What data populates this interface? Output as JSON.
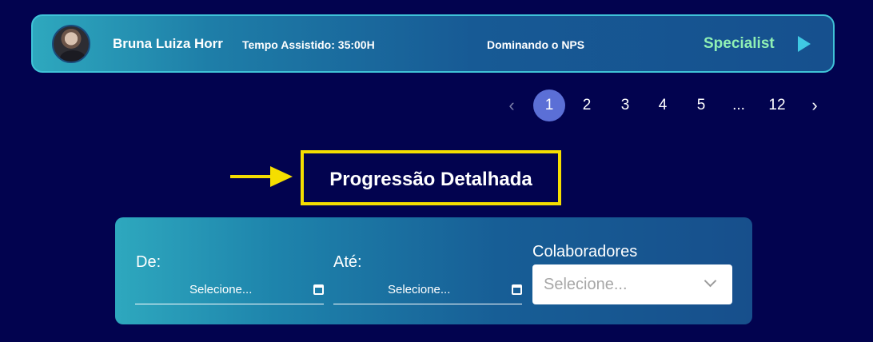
{
  "user_card": {
    "name": "Bruna Luiza Horr",
    "watch_time": "Tempo Assistido: 35:00H",
    "course": "Dominando o NPS",
    "level": "Specialist"
  },
  "pagination": {
    "prev": "‹",
    "pages": [
      "1",
      "2",
      "3",
      "4",
      "5",
      "...",
      "12"
    ],
    "active": "1",
    "next": "›"
  },
  "section": {
    "title": "Progressão Detalhada"
  },
  "filters": {
    "from_label": "De:",
    "from_value": "Selecione...",
    "to_label": "Até:",
    "to_value": "Selecione...",
    "collaborators_label": "Colaboradores",
    "collaborators_placeholder": "Selecione..."
  },
  "colors": {
    "background": "#02034f",
    "accent_highlight": "#f5de00",
    "level_text": "#8ff0b4",
    "active_page": "#5b6fd6"
  }
}
